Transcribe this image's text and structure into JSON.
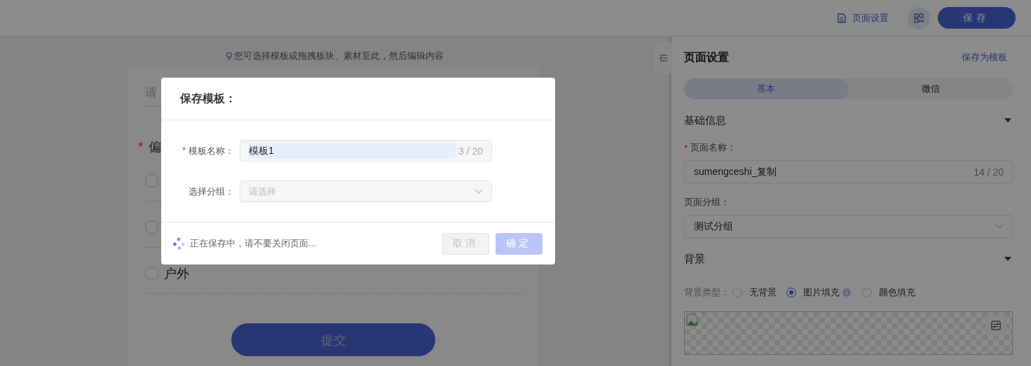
{
  "header": {
    "page_settings_link": "页面设置",
    "save_button": "保存"
  },
  "canvas": {
    "hint": "您可选择模板或拖拽板块、素材至此，然后编辑内容",
    "form": {
      "title_placeholder": "请",
      "question": {
        "required_mark": "*",
        "title": "偏",
        "options": [
          {
            "selected": false
          },
          {
            "selected": false
          },
          {
            "label": "户外",
            "selected": false
          }
        ]
      },
      "submit_button": "提交"
    }
  },
  "panel": {
    "title": "页面设置",
    "save_as_template": "保存为模板",
    "tabs": [
      {
        "label": "基本",
        "selected": true
      },
      {
        "label": "微信",
        "selected": false
      }
    ],
    "basic_info": {
      "title": "基础信息",
      "expanded": true,
      "page_name": {
        "label": "页面名称：",
        "required_mark": "*",
        "value": "sumengceshi_复制",
        "count": "14 / 20"
      },
      "page_group": {
        "label": "页面分组：",
        "value": "测试分组"
      }
    },
    "background": {
      "title": "背景",
      "expanded": true,
      "type_label": "背景类型：",
      "types": [
        {
          "label": "无背景",
          "selected": false,
          "info": false
        },
        {
          "label": "图片填充",
          "selected": true,
          "info": true
        },
        {
          "label": "颜色填充",
          "selected": false,
          "info": false
        }
      ]
    }
  },
  "modal": {
    "title": "保存模板：",
    "fields": [
      {
        "kind": "text",
        "label": "模板名称：",
        "required_mark": "*",
        "value": "模板1",
        "text_selected": true,
        "count": "3 / 20"
      },
      {
        "kind": "select",
        "label": "选择分组：",
        "placeholder": "请选择"
      }
    ],
    "status": {
      "loading": true,
      "text": "正在保存中，请不要关闭页面..."
    },
    "buttons": [
      {
        "label": "取消",
        "kind": "default",
        "disabled": true
      },
      {
        "label": "确定",
        "kind": "primary",
        "disabled": true
      }
    ]
  }
}
